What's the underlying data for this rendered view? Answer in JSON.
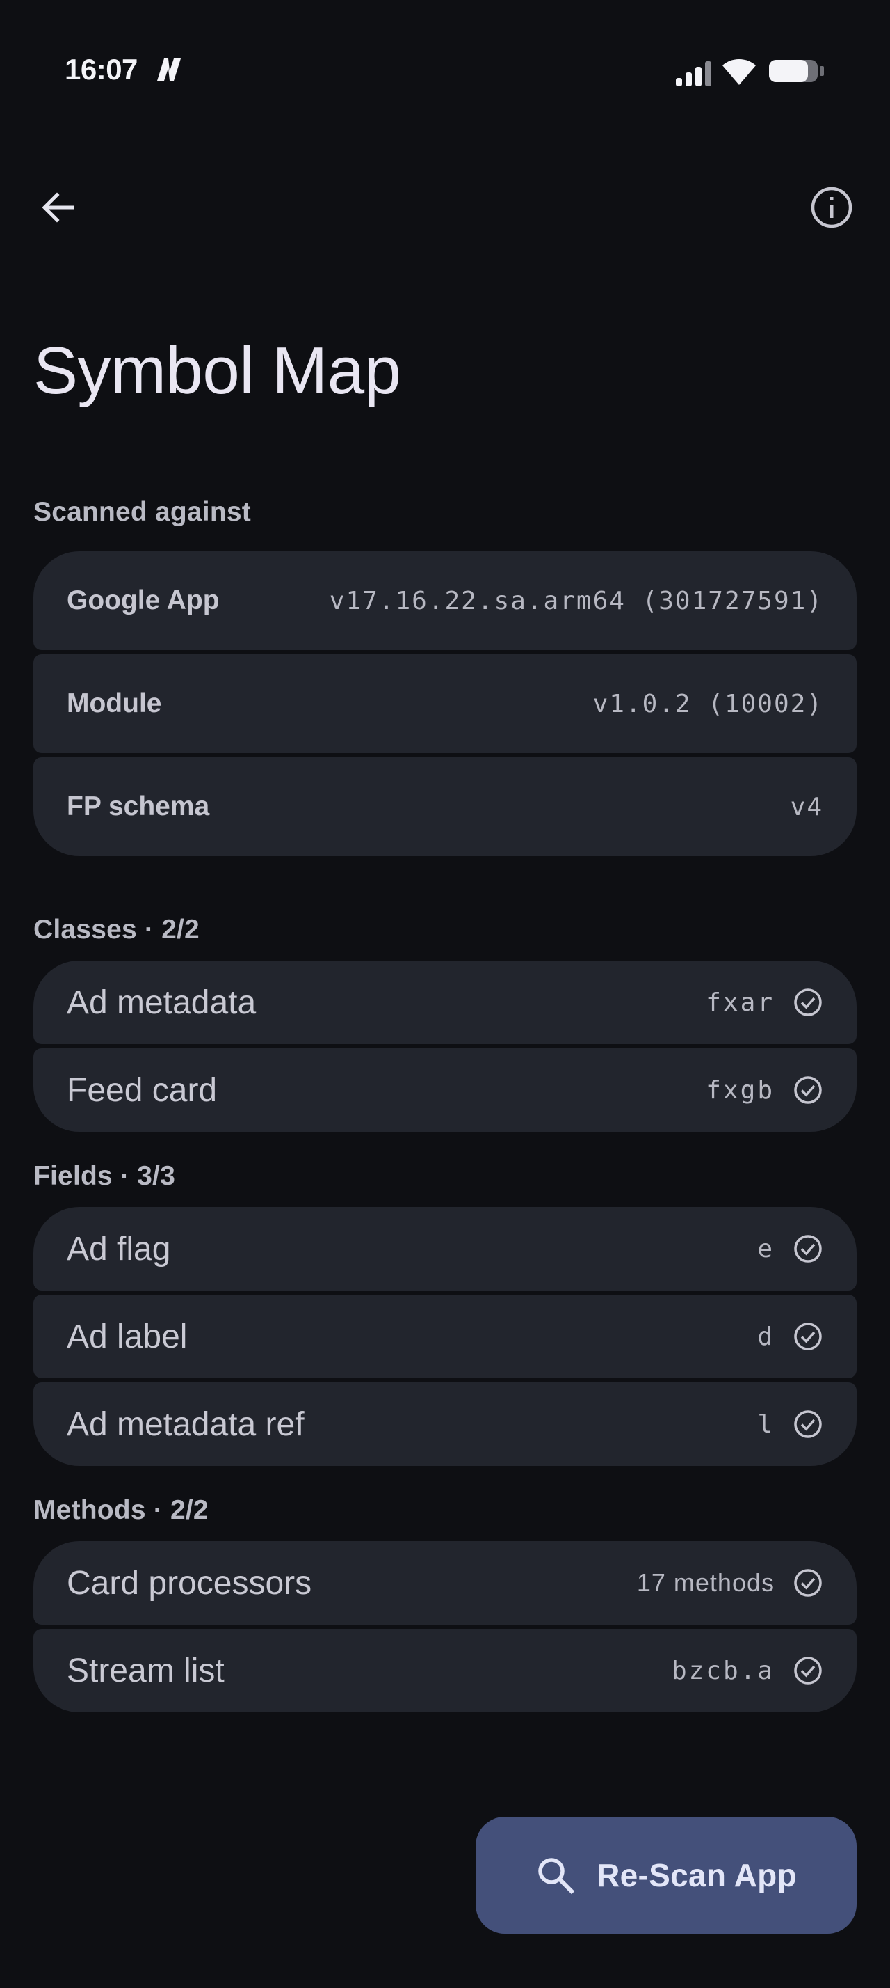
{
  "status_bar": {
    "time": "16:07",
    "icons": [
      "n-badge-icon",
      "signal-icon",
      "wifi-icon",
      "battery-icon"
    ]
  },
  "app_bar": {
    "back_icon": "arrow-back-icon",
    "info_icon": "info-icon"
  },
  "page": {
    "title": "Symbol Map"
  },
  "scanned": {
    "label": "Scanned against",
    "rows": [
      {
        "key": "Google App",
        "value": "v17.16.22.sa.arm64 (301727591)"
      },
      {
        "key": "Module",
        "value": "v1.0.2 (10002)"
      },
      {
        "key": "FP schema",
        "value": "v4"
      }
    ]
  },
  "classes": {
    "label": "Classes · 2/2",
    "rows": [
      {
        "name": "Ad metadata",
        "code": "fxar",
        "status": "check-circle-icon"
      },
      {
        "name": "Feed card",
        "code": "fxgb",
        "status": "check-circle-icon"
      }
    ]
  },
  "fields": {
    "label": "Fields · 3/3",
    "rows": [
      {
        "name": "Ad flag",
        "code": "e",
        "status": "check-circle-icon"
      },
      {
        "name": "Ad label",
        "code": "d",
        "status": "check-circle-icon"
      },
      {
        "name": "Ad metadata ref",
        "code": "l",
        "status": "check-circle-icon"
      }
    ]
  },
  "methods": {
    "label": "Methods · 2/2",
    "rows": [
      {
        "name": "Card processors",
        "code": "17 methods",
        "status": "check-circle-icon"
      },
      {
        "name": "Stream list",
        "code": "bzcb.a",
        "status": "check-circle-icon"
      }
    ]
  },
  "fab": {
    "icon": "search-icon",
    "label": "Re-Scan App"
  },
  "colors": {
    "background": "#0e0f13",
    "row": "#22252d",
    "fab": "#44507a",
    "text": "#e6e6ef",
    "muted": "#b9bac4"
  }
}
